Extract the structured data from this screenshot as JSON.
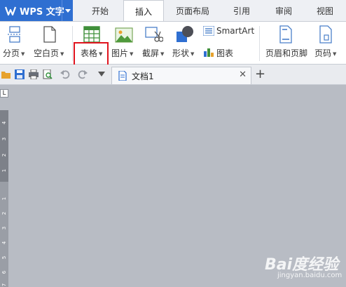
{
  "app": {
    "name": "WPS 文字"
  },
  "menu_tabs": [
    {
      "label": "开始"
    },
    {
      "label": "插入"
    },
    {
      "label": "页面布局"
    },
    {
      "label": "引用"
    },
    {
      "label": "审阅"
    },
    {
      "label": "视图"
    }
  ],
  "ribbon": {
    "page_break": "分页",
    "blank_page": "空白页",
    "table": "表格",
    "picture": "图片",
    "screenshot": "截屏",
    "shapes": "形状",
    "smartart": "SmartArt",
    "chart": "图表",
    "header_footer": "页眉和页脚",
    "page_number": "页码"
  },
  "doc_tab": {
    "name": "文档1"
  },
  "ruler_numbers": [
    "4",
    "3",
    "2",
    "1",
    "1",
    "2",
    "3",
    "4",
    "5",
    "6",
    "7"
  ],
  "watermark": {
    "brand": "Bai度经验",
    "sub": "jingyan.baidu.com"
  },
  "colors": {
    "accent": "#2f6fd1",
    "highlight": "#e0141e"
  }
}
